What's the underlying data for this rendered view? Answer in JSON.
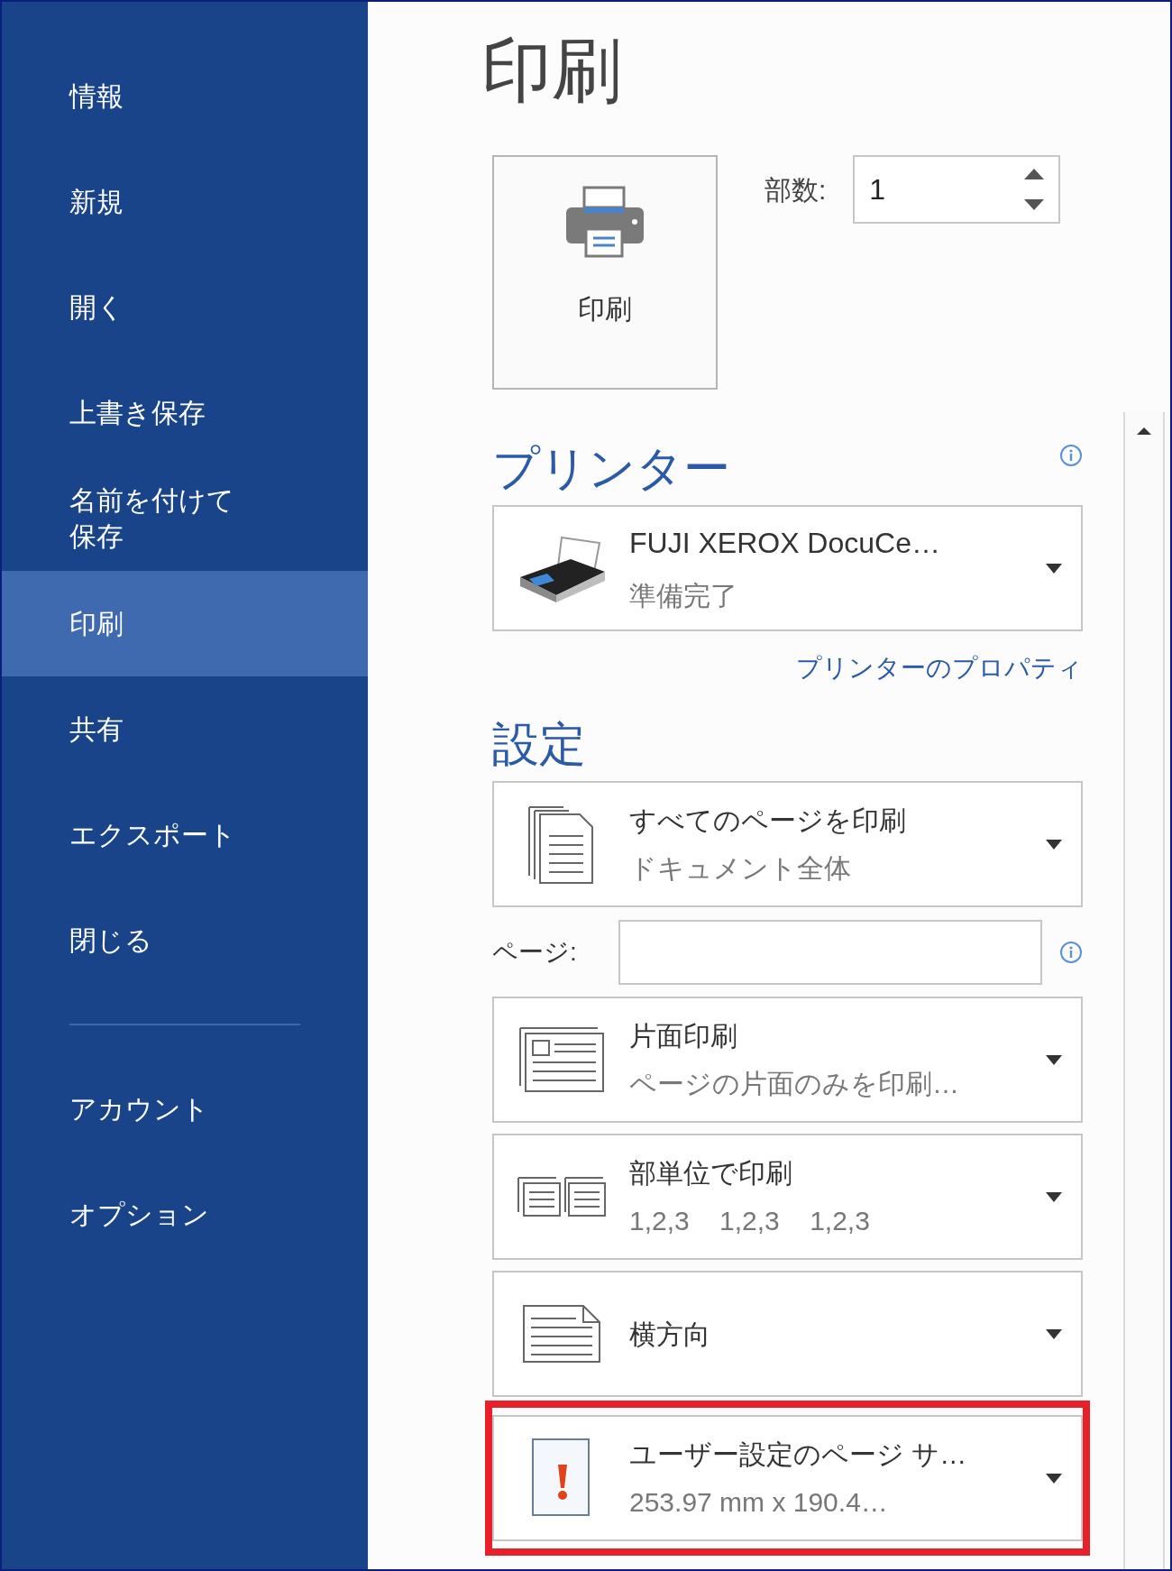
{
  "sidebar": {
    "items": [
      {
        "label": "情報",
        "selected": false
      },
      {
        "label": "新規",
        "selected": false
      },
      {
        "label": "開く",
        "selected": false
      },
      {
        "label": "上書き保存",
        "selected": false
      },
      {
        "label": "名前を付けて保存",
        "selected": false
      },
      {
        "label": "印刷",
        "selected": true
      },
      {
        "label": "共有",
        "selected": false
      },
      {
        "label": "エクスポート",
        "selected": false
      },
      {
        "label": "閉じる",
        "selected": false
      }
    ],
    "footer_items": [
      {
        "label": "アカウント",
        "selected": false
      },
      {
        "label": "オプション",
        "selected": false
      }
    ]
  },
  "title": "印刷",
  "print_button": {
    "label": "印刷"
  },
  "copies": {
    "label": "部数:",
    "value": "1"
  },
  "printer": {
    "heading": "プリンター",
    "name": "FUJI XEROX DocuCe…",
    "status": "準備完了",
    "properties_link": "プリンターのプロパティ"
  },
  "settings": {
    "heading": "設定",
    "items": [
      {
        "kind": "pages",
        "title": "すべてのページを印刷",
        "subtitle": "ドキュメント全体",
        "highlighted": false
      },
      {
        "kind": "page_range",
        "label": "ページ:"
      },
      {
        "kind": "sides",
        "title": "片面印刷",
        "subtitle": "ページの片面のみを印刷…",
        "highlighted": false
      },
      {
        "kind": "collate",
        "title": "部単位で印刷",
        "subtitle": "1,2,3    1,2,3    1,2,3",
        "highlighted": false
      },
      {
        "kind": "orientation",
        "title": "横方向",
        "highlighted": false
      },
      {
        "kind": "paper_size",
        "title": "ユーザー設定のページ サ…",
        "subtitle": "253.97 mm x 190.4…",
        "highlighted": true
      }
    ]
  }
}
